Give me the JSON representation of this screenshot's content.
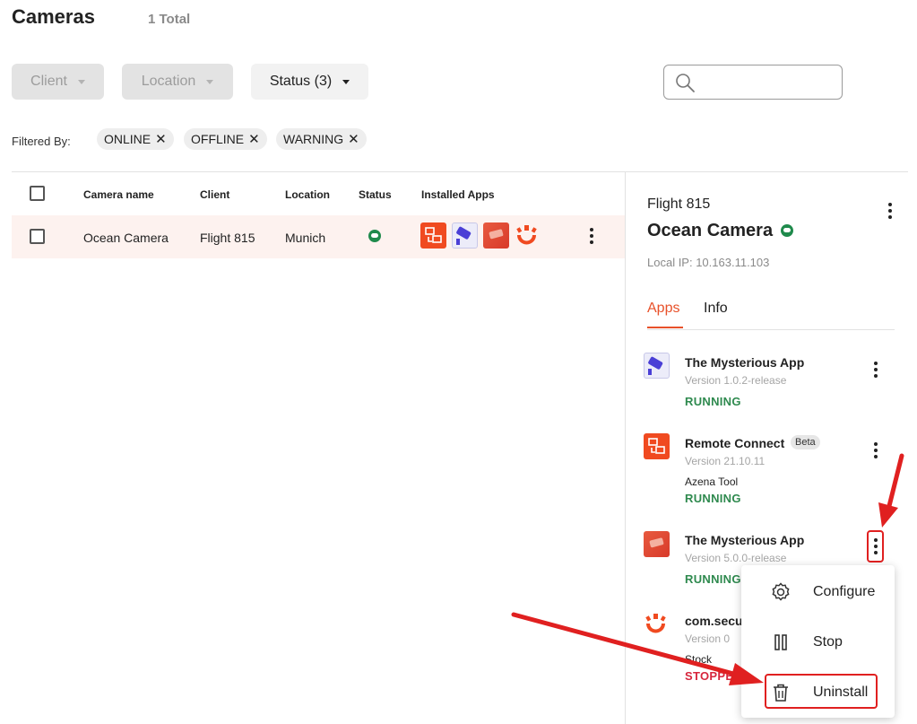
{
  "header": {
    "title": "Cameras",
    "total": "1 Total"
  },
  "filters": {
    "client": "Client",
    "location": "Location",
    "status": "Status (3)",
    "filtered_by_label": "Filtered By:",
    "chips": [
      "ONLINE",
      "OFFLINE",
      "WARNING"
    ]
  },
  "table": {
    "columns": [
      "Camera name",
      "Client",
      "Location",
      "Status",
      "Installed Apps"
    ],
    "rows": [
      {
        "camera_name": "Ocean Camera",
        "client": "Flight 815",
        "location": "Munich",
        "status_icon": "cloud-online-icon"
      }
    ]
  },
  "panel": {
    "client": "Flight 815",
    "camera_name": "Ocean Camera",
    "local_ip": "Local IP: 10.163.11.103",
    "tabs": [
      "Apps",
      "Info"
    ],
    "apps": [
      {
        "name": "The Mysterious App",
        "version": "Version 1.0.2-release",
        "subtitle": "",
        "status": "RUNNING",
        "icon": "camera-icon"
      },
      {
        "name": "Remote Connect",
        "badge": "Beta",
        "version": "Version 21.10.11",
        "subtitle": "Azena Tool",
        "status": "RUNNING",
        "icon": "remote-connect-icon"
      },
      {
        "name": "The Mysterious App",
        "version": "Version 5.0.0-release",
        "subtitle": "",
        "status": "RUNNING",
        "icon": "mysterious-app-icon"
      },
      {
        "name": "com.secu",
        "version": "Version 0",
        "subtitle": "Stock",
        "status": "STOPPE",
        "icon": "azena-logo-icon"
      }
    ]
  },
  "context_menu": {
    "items": [
      {
        "label": "Configure",
        "icon": "gear-icon"
      },
      {
        "label": "Stop",
        "icon": "pause-icon"
      },
      {
        "label": "Uninstall",
        "icon": "trash-icon"
      }
    ]
  },
  "colors": {
    "accent": "#e8512a",
    "running": "#2f8a4f",
    "stopped": "#d7263d",
    "annotation": "#e02020"
  }
}
